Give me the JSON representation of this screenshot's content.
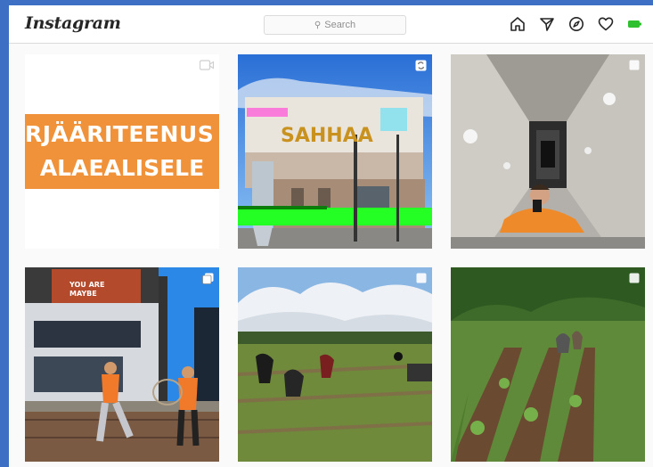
{
  "app": {
    "logo_text": "Instagram"
  },
  "search": {
    "placeholder": "Search"
  },
  "nav_icons": [
    "home-icon",
    "direct-icon",
    "explore-icon",
    "activity-icon",
    "battery-icon"
  ],
  "posts": [
    {
      "type": "video",
      "line1": "RJÄÄRITEENUS",
      "line2": "ALAEALISELE"
    },
    {
      "type": "carousel",
      "sign_text": "SAHHAA"
    },
    {
      "type": "image"
    },
    {
      "type": "image",
      "poster_text": "YOU ARE",
      "poster_subtext": "MAYBE"
    },
    {
      "type": "image"
    },
    {
      "type": "image"
    }
  ],
  "colors": {
    "accent_orange": "#f0923a",
    "glitch_green": "#24ff24",
    "bg_blue": "#3d6fc4"
  }
}
